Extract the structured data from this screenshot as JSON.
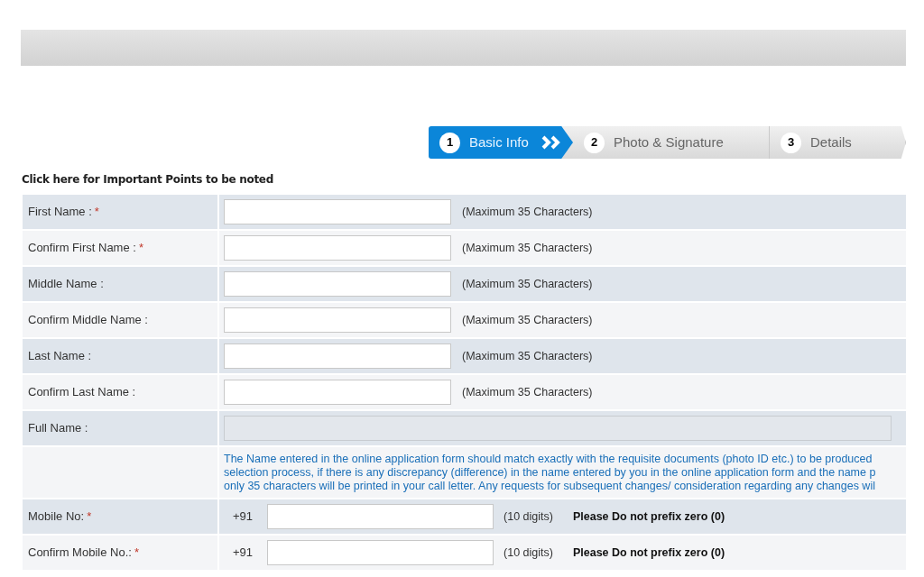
{
  "steps": [
    {
      "number": "1",
      "label": "Basic Info",
      "selected": true
    },
    {
      "number": "2",
      "label": "Photo & Signature",
      "selected": false
    },
    {
      "number": "3",
      "label": "Details",
      "selected": false
    }
  ],
  "important_link": "Click here for Important Points to be noted",
  "rows": [
    {
      "kind": "text",
      "label": "First Name :",
      "asterisk": "*",
      "hint": "(Maximum 35 Characters)"
    },
    {
      "kind": "text",
      "label": "Confirm First Name :",
      "asterisk": "*",
      "hint": "(Maximum 35 Characters)"
    },
    {
      "kind": "text",
      "label": "Middle Name :",
      "hint": "(Maximum 35 Characters)"
    },
    {
      "kind": "text",
      "label": "Confirm Middle Name :",
      "hint": "(Maximum 35 Characters)"
    },
    {
      "kind": "text",
      "label": "Last Name :",
      "hint": "(Maximum 35 Characters)"
    },
    {
      "kind": "text",
      "label": "Confirm Last Name :",
      "hint": "(Maximum 35 Characters)"
    },
    {
      "kind": "readonly",
      "label": "Full Name :"
    },
    {
      "kind": "note",
      "lines": [
        "The Name entered in the online application form should match exactly with the requisite documents (photo ID etc.) to be produced",
        "selection process, if there is any discrepancy (difference) in the name entered by you in the online application form and the name p",
        "only 35 characters will be printed in your call letter. Any requests for subsequent changes/ consideration regarding any changes wil"
      ]
    },
    {
      "kind": "phone",
      "label": "Mobile No:",
      "asterisk": "*",
      "prefix": "+91",
      "hint": "(10 digits)",
      "warning": "Please Do not prefix zero (0)"
    },
    {
      "kind": "phone",
      "label": "Confirm Mobile No.:",
      "asterisk": "*",
      "prefix": "+91",
      "hint": "(10 digits)",
      "warning": "Please Do not prefix zero (0)"
    }
  ]
}
